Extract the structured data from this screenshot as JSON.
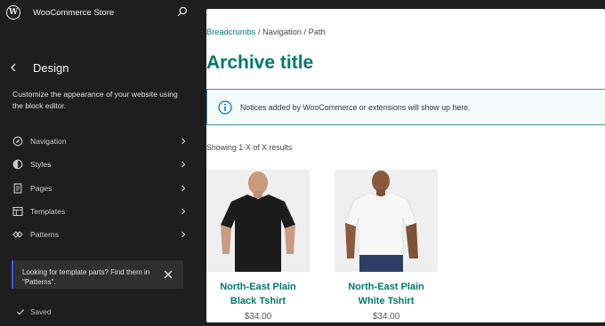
{
  "header": {
    "site_title": "WooCommerce Store"
  },
  "sidebar": {
    "title": "Design",
    "description": "Customize the appearance of your website using the block editor.",
    "items": [
      {
        "label": "Navigation",
        "icon": "navigation-icon"
      },
      {
        "label": "Styles",
        "icon": "styles-icon"
      },
      {
        "label": "Pages",
        "icon": "pages-icon"
      },
      {
        "label": "Templates",
        "icon": "templates-icon"
      },
      {
        "label": "Patterns",
        "icon": "patterns-icon"
      }
    ],
    "notice": {
      "text": "Looking for template parts? Find them in \"Patterns\"."
    },
    "status": "Saved"
  },
  "canvas": {
    "breadcrumb_link": "Breadcrumbs",
    "breadcrumb_rest": " / Navigation / Path",
    "archive_title": "Archive title",
    "notice_text": "Notices added by WooCommerce or extensions will show up here.",
    "result_count": "Showing 1-X of X results",
    "products": [
      {
        "title": "North-East Plain Black Tshirt",
        "price": "$34.00"
      },
      {
        "title": "North-East Plain White Tshirt",
        "price": "$34.00"
      }
    ]
  },
  "colors": {
    "accent": "#00796b",
    "sidebar_bg": "#1e1e1e",
    "notice_border": "#3858e9"
  }
}
